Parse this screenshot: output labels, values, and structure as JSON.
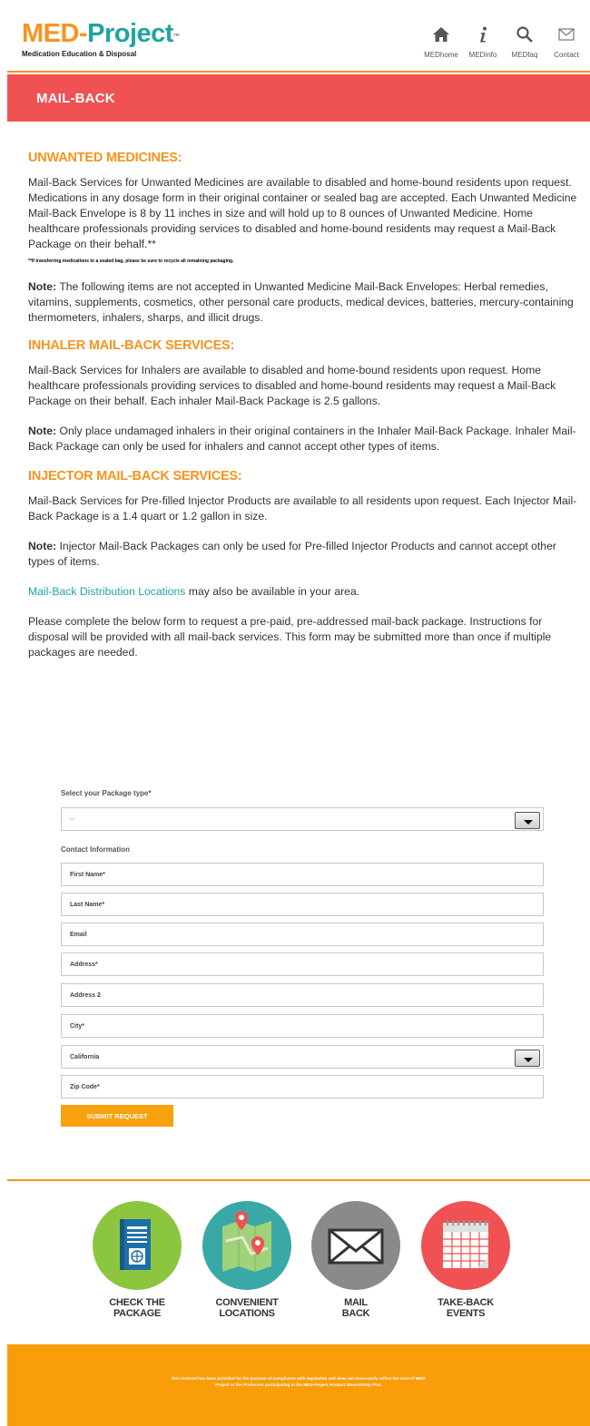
{
  "header": {
    "logo_med": "MED-",
    "logo_project": "Project",
    "logo_tm": "™",
    "logo_subtitle": "Medication Education & Disposal",
    "nav": [
      {
        "label": "MEDhome",
        "icon": "home-icon"
      },
      {
        "label": "MEDinfo",
        "icon": "info-icon"
      },
      {
        "label": "MEDfaq",
        "icon": "search-icon"
      },
      {
        "label": "Contact",
        "icon": "mail-icon"
      }
    ]
  },
  "banner": {
    "title": "MAIL-BACK"
  },
  "unwanted": {
    "heading": "UNWANTED MEDICINES:",
    "body": "Mail-Back Services for Unwanted Medicines are available to disabled and home-bound residents upon request. Medications in any dosage form in their original container or sealed bag are accepted.  Each Unwanted Medicine Mail-Back Envelope is 8 by 11 inches in size and will hold up to 8 ounces of Unwanted Medicine.  Home healthcare professionals providing services to disabled and home-bound residents may request a Mail-Back Package on their behalf.**",
    "fine_print": "**If transferring medications to a sealed bag, please be sure to recycle all remaining packaging.",
    "note_label": "Note:",
    "note": " The following items are not accepted in Unwanted Medicine Mail-Back Envelopes: Herbal remedies, vitamins, supplements, cosmetics, other personal care products, medical devices, batteries, mercury-containing thermometers, inhalers, sharps, and illicit drugs."
  },
  "inhaler": {
    "heading": "INHALER MAIL-BACK SERVICES:",
    "body": "Mail-Back Services for Inhalers are available to disabled and home-bound residents upon request. Home healthcare professionals providing services to disabled and home-bound residents may request a Mail-Back Package on their behalf. Each inhaler Mail-Back Package is 2.5 gallons.",
    "note_label": "Note:",
    "note": " Only place undamaged inhalers in their original containers in the Inhaler Mail-Back Package. Inhaler Mail-Back Package can only be used for inhalers and cannot accept other types of items."
  },
  "injector": {
    "heading": "INJECTOR MAIL-BACK SERVICES:",
    "body": "Mail-Back Services for Pre-filled Injector Products are available to all residents upon request. Each Injector Mail-Back Package is a 1.4 quart or 1.2 gallon in size.",
    "note_label": "Note:",
    "note": " Injector Mail-Back Packages can only be used for Pre-filled Injector Products and cannot accept other types of items."
  },
  "distribution": {
    "link": "Mail-Back Distribution Locations",
    "rest": " may also be available in your area."
  },
  "instructions": "Please complete the below form to request a pre-paid, pre-addressed mail-back package. Instructions for disposal will be provided with all mail-back services.  This form may be submitted more than once if multiple packages are needed.",
  "form": {
    "package_label": "Select your Package type*",
    "package_value": "--",
    "contact_label": "Contact Information",
    "first_name": "First Name*",
    "last_name": "Last Name*",
    "email": "Email",
    "address": "Address*",
    "address2": "Address 2",
    "city": "City*",
    "state": "California",
    "zip": "Zip Code*",
    "submit": "SUBMIT REQUEST"
  },
  "cta": [
    {
      "line1": "CHECK THE",
      "line2": "PACKAGE",
      "icon": "package-icon",
      "color": "#8cc63f"
    },
    {
      "line1": "CONVENIENT",
      "line2": "LOCATIONS",
      "icon": "map-icon",
      "color": "#3aa8a6"
    },
    {
      "line1": "MAIL",
      "line2": "BACK",
      "icon": "envelope-icon",
      "color": "#8a8a8a"
    },
    {
      "line1": "TAKE-BACK",
      "line2": "EVENTS",
      "icon": "calendar-icon",
      "color": "#f05253"
    }
  ],
  "footer": {
    "line1": "This material has been provided for the purpose of compliance with legislation and does not necessarily reflect the view of MED-",
    "line2": "Project or the Producers participating in the MED-Project Product Stewardship Plan."
  }
}
